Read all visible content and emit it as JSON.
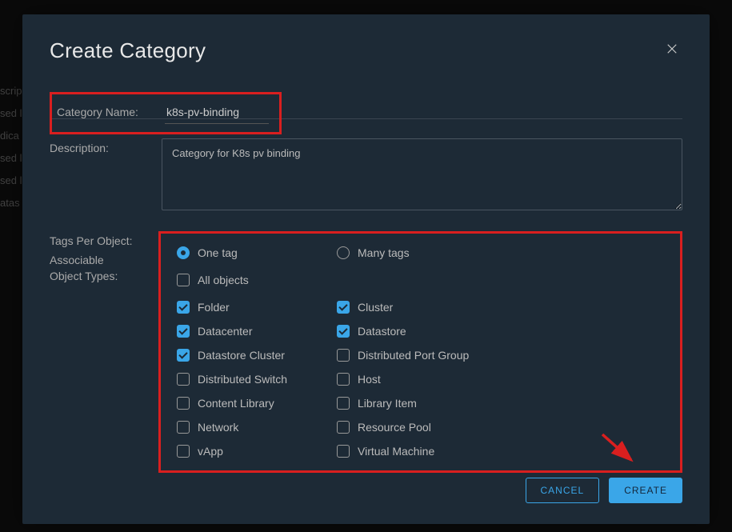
{
  "modal": {
    "title": "Create Category",
    "labels": {
      "categoryName": "Category Name:",
      "description": "Description:",
      "tagsPerObject": "Tags Per Object:",
      "associableTypes1": "Associable",
      "associableTypes2": "Object Types:"
    },
    "fields": {
      "categoryName": "k8s-pv-binding",
      "description": "Category for K8s pv binding"
    },
    "tagsPerObject": {
      "options": [
        {
          "label": "One tag",
          "selected": true
        },
        {
          "label": "Many tags",
          "selected": false
        }
      ]
    },
    "objectTypes": {
      "allObjects": {
        "label": "All objects",
        "checked": false
      },
      "col1": [
        {
          "label": "Folder",
          "checked": true
        },
        {
          "label": "Datacenter",
          "checked": true
        },
        {
          "label": "Datastore Cluster",
          "checked": true
        },
        {
          "label": "Distributed Switch",
          "checked": false
        },
        {
          "label": "Content Library",
          "checked": false
        },
        {
          "label": "Network",
          "checked": false
        },
        {
          "label": "vApp",
          "checked": false
        }
      ],
      "col2": [
        {
          "label": "Cluster",
          "checked": true
        },
        {
          "label": "Datastore",
          "checked": true
        },
        {
          "label": "Distributed Port Group",
          "checked": false
        },
        {
          "label": "Host",
          "checked": false
        },
        {
          "label": "Library Item",
          "checked": false
        },
        {
          "label": "Resource Pool",
          "checked": false
        },
        {
          "label": "Virtual Machine",
          "checked": false
        }
      ]
    },
    "buttons": {
      "cancel": "CANCEL",
      "create": "CREATE"
    }
  }
}
